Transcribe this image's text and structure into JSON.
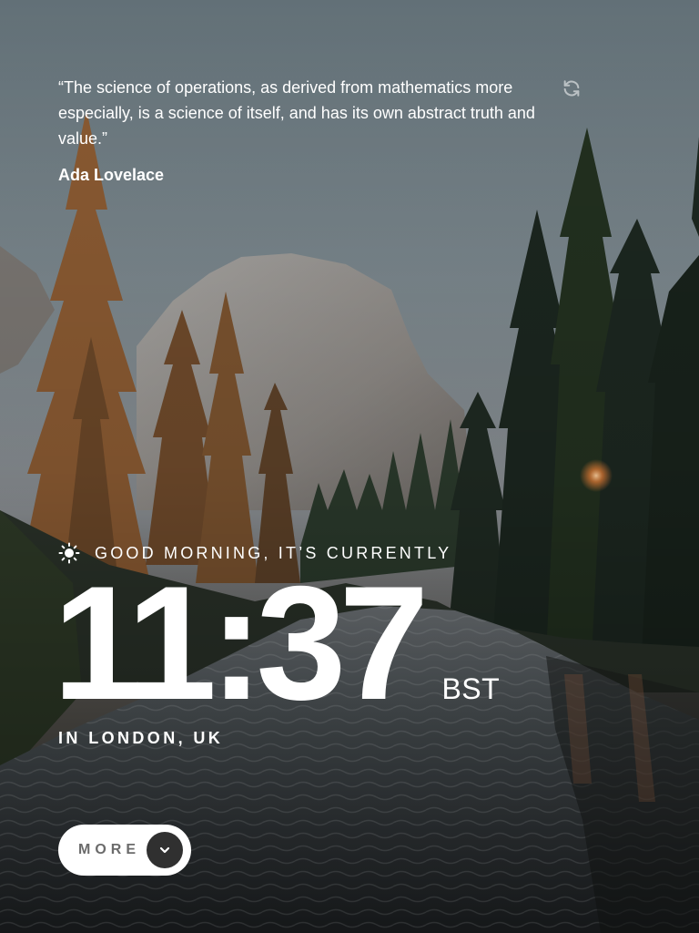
{
  "quote": {
    "text": "“The science of operations, as derived from mathematics more especially, is a science of itself, and has its own abstract truth and value.”",
    "author": "Ada Lovelace"
  },
  "greeting": {
    "icon": "sun-icon",
    "text": "Good morning, it’s currently"
  },
  "clock": {
    "time": "11:37",
    "timezone": "BST",
    "location": "In London, UK"
  },
  "more_button": {
    "label": "More",
    "icon": "chevron-down-icon"
  },
  "icons": {
    "refresh": "refresh-icon"
  },
  "colors": {
    "text": "#ffffff",
    "button_bg": "#ffffff",
    "button_text": "#6b6b6b",
    "chevron_bg": "#303030"
  }
}
